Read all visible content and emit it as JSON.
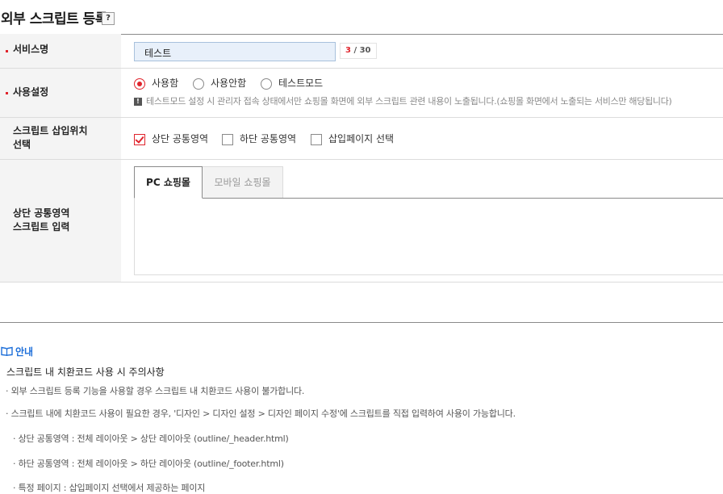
{
  "header": {
    "title": "외부 스크립트 등록",
    "help_label": "?"
  },
  "form": {
    "service_name": {
      "label": "서비스명",
      "value": "테스트",
      "count_current": "3",
      "count_sep": " / ",
      "count_max": "30"
    },
    "usage": {
      "label": "사용설정",
      "options": [
        "사용함",
        "사용안함",
        "테스트모드"
      ],
      "selected": "사용함",
      "notice": "테스트모드 설정 시 관리자 접속 상태에서만 쇼핑몰 화면에 외부 스크립트 관련 내용이 노출됩니다.(쇼핑몰 화면에서 노출되는 서비스만 해당됩니다)"
    },
    "insert_position": {
      "label_line1": "스크립트 삽입위치",
      "label_line2": "선택",
      "options": [
        "상단 공통영역",
        "하단 공통영역",
        "삽입페이지 선택"
      ],
      "checked": [
        "상단 공통영역"
      ]
    },
    "script_input": {
      "label_line1": "상단 공통영역",
      "label_line2": "스크립트 입력",
      "tabs": [
        "PC 쇼핑몰",
        "모바일 쇼핑몰"
      ],
      "active_tab": "PC 쇼핑몰",
      "content": ""
    }
  },
  "guide": {
    "heading": "안내",
    "subtitle": "스크립트 내 치환코드 사용 시 주의사항",
    "lines": [
      "· 외부 스크립트 등록 기능을 사용할 경우 스크립트 내 치환코드 사용이 불가합니다.",
      "· 스크립트 내에 치환코드 사용이 필요한 경우, '디자인 > 디자인 설정 > 디자인 페이지 수정'에 스크립트를 직접 입력하여 사용이 가능합니다.",
      "· 상단 공통영역 : 전체 레이아웃 > 상단 레이아웃 (outline/_header.html)",
      "· 하단 공통영역 : 전체 레이아웃 > 하단 레이아웃 (outline/_footer.html)",
      "· 특정 페이지 : 삽입페이지 선택에서 제공하는 페이지"
    ]
  },
  "colors": {
    "accent_red": "#e0242c",
    "link_blue": "#1e6fd9",
    "label_bg": "#f4f4f4"
  }
}
